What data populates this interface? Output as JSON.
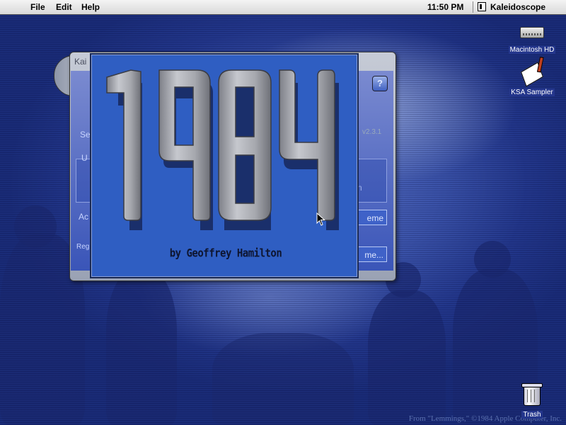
{
  "menubar": {
    "apple_glyph": "",
    "menus": [
      "File",
      "Edit",
      "Help"
    ],
    "clock": "11:50 PM",
    "app_name": "Kaleidoscope"
  },
  "desktop": {
    "icons": {
      "hd": "Macintosh HD",
      "ksa": "KSA Sampler",
      "trash": "Trash"
    },
    "credit": "From \"Lemmings,\" ©1984 Apple Computer, Inc."
  },
  "control_panel": {
    "title_fragment": "Kai",
    "version_fragment": "v2.3.1",
    "learn_fragment": "rn",
    "theme_button_fragment": "eme",
    "theme_button2_fragment": "me...",
    "left_frag_tab": "Se",
    "left_frag_use": "U",
    "left_frag_act": "Ac",
    "left_frag_reg": "Reg",
    "help_glyph": "?"
  },
  "splash": {
    "title": "1984",
    "byline": "by Geoffrey Hamilton"
  },
  "colors": {
    "desktop_blue": "#2a40a0",
    "splash_blue": "#2f5ec2",
    "digit_gray": "#a8aab0"
  }
}
